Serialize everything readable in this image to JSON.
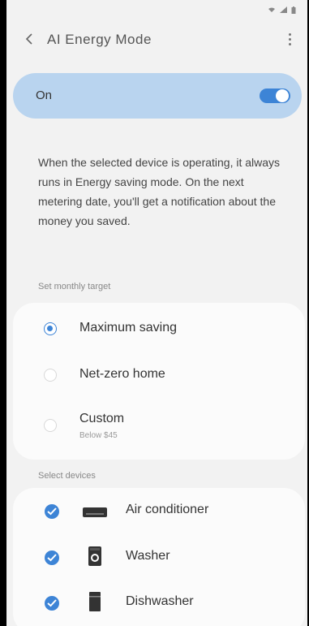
{
  "status_bar": {
    "wifi_icon": "wifi-icon",
    "signal_icon": "signal-icon",
    "battery_icon": "battery-icon"
  },
  "app_bar": {
    "title": "AI Energy Mode",
    "back_icon": "back-chevron-icon",
    "more_icon": "more-vertical-icon"
  },
  "toggle": {
    "label": "On",
    "state": "on",
    "accent": "#3d84d6"
  },
  "description": "When the selected device is operating, it always runs in Energy saving mode. On the next metering date, you'll get a notification about the money you saved.",
  "target": {
    "section_label": "Set monthly target",
    "options": [
      {
        "label": "Maximum saving",
        "sublabel": "",
        "selected": true
      },
      {
        "label": "Net-zero home",
        "sublabel": "",
        "selected": false
      },
      {
        "label": "Custom",
        "sublabel": "Below $45",
        "selected": false
      }
    ]
  },
  "devices": {
    "section_label": "Select devices",
    "items": [
      {
        "label": "Air conditioner",
        "icon": "air-conditioner-icon",
        "checked": true
      },
      {
        "label": "Washer",
        "icon": "washer-icon",
        "checked": true
      },
      {
        "label": "Dishwasher",
        "icon": "dishwasher-icon",
        "checked": true
      }
    ]
  }
}
